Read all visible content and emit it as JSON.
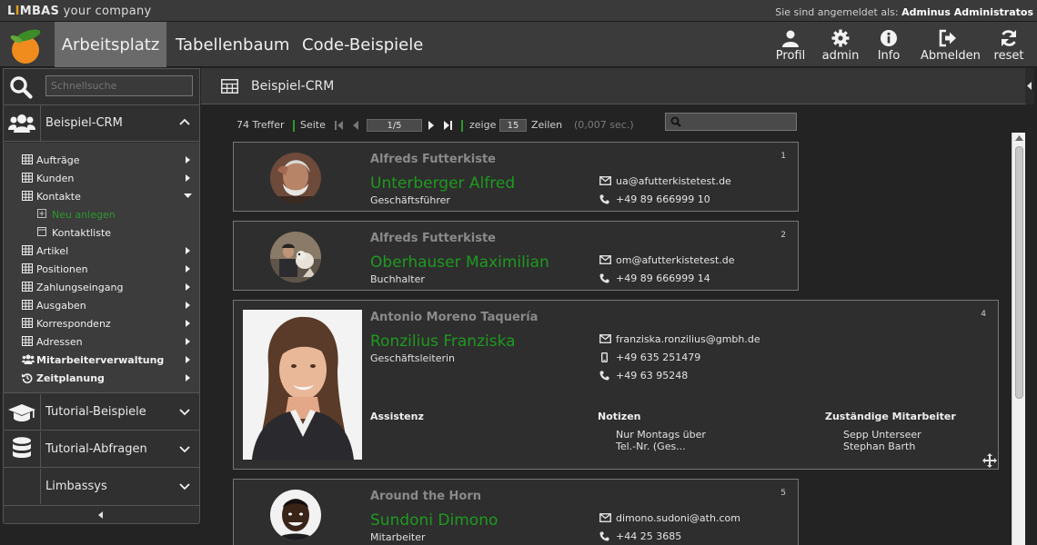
{
  "brand": {
    "name_prefix": "L",
    "name_i": "I",
    "name_suffix": "MBAS",
    "tagline": "your company"
  },
  "session": {
    "label": "Sie sind angemeldet als:",
    "user": "Adminus Administratos"
  },
  "nav": {
    "tabs": [
      {
        "label": "Arbeitsplatz",
        "active": true
      },
      {
        "label": "Tabellenbaum",
        "active": false
      },
      {
        "label": "Code-Beispiele",
        "active": false
      }
    ],
    "tools": [
      {
        "label": "Profil",
        "icon": "user-icon"
      },
      {
        "label": "admin",
        "icon": "gear-icon"
      },
      {
        "label": "Info",
        "icon": "info-icon"
      },
      {
        "label": "Abmelden",
        "icon": "logout-icon"
      },
      {
        "label": "reset",
        "icon": "refresh-icon"
      }
    ]
  },
  "sidebar": {
    "search_placeholder": "Schnellsuche",
    "groups": [
      {
        "label": "Beispiel-CRM",
        "icon": "users-icon",
        "expanded": true
      },
      {
        "label": "Tutorial-Beispiele",
        "icon": "graduation-cap-icon",
        "expanded": false
      },
      {
        "label": "Tutorial-Abfragen",
        "icon": "database-icon",
        "expanded": false
      },
      {
        "label": "Limbassys",
        "icon": "",
        "expanded": false
      }
    ],
    "tree": [
      {
        "label": "Aufträge",
        "icon": "table-icon"
      },
      {
        "label": "Kunden",
        "icon": "table-icon"
      },
      {
        "label": "Kontakte",
        "icon": "table-icon",
        "open": true
      },
      {
        "label": "Neu anlegen",
        "icon": "plus-square-icon",
        "sub": true
      },
      {
        "label": "Kontaktliste",
        "icon": "list-icon",
        "sub": true
      },
      {
        "label": "Artikel",
        "icon": "table-icon"
      },
      {
        "label": "Positionen",
        "icon": "table-icon"
      },
      {
        "label": "Zahlungseingang",
        "icon": "table-icon"
      },
      {
        "label": "Ausgaben",
        "icon": "table-icon"
      },
      {
        "label": "Korrespondenz",
        "icon": "table-icon"
      },
      {
        "label": "Adressen",
        "icon": "table-icon"
      },
      {
        "label": "Mitarbeiterverwaltung",
        "icon": "users-icon"
      },
      {
        "label": "Zeitplanung",
        "icon": "history-icon"
      }
    ]
  },
  "content": {
    "title": "Beispiel-CRM",
    "pager": {
      "hits": "74 Treffer",
      "page_label": "Seite",
      "page_value": "1/5",
      "show_label": "zeige",
      "rows_value": "15",
      "rows_label": "Zeilen",
      "timing": "(0,007 sec.)"
    },
    "cards": [
      {
        "num": "1",
        "company": "Alfreds Futterkiste",
        "name": "Unterberger Alfred",
        "role": "Geschäftsführer",
        "email": "ua@afutterkistetest.de",
        "phone": "+49 89 666999 10"
      },
      {
        "num": "2",
        "company": "Alfreds Futterkiste",
        "name": "Oberhauser Maximilian",
        "role": "Buchhalter",
        "email": "om@afutterkistetest.de",
        "phone": "+49 89 666999 14"
      },
      {
        "num": "4",
        "company": "Antonio Moreno Taquería",
        "name": "Ronzilius Franziska",
        "role": "Geschäftsleiterin",
        "email": "franziska.ronzilius@gmbh.de",
        "mobile": "+49 635 251479",
        "phone": "+49 63 95248",
        "sections": {
          "assistant_label": "Assistenz",
          "notes_label": "Notizen",
          "notes_text_1": "Nur Montags über",
          "notes_text_2": "Tel.-Nr. (Ges...",
          "staff_label": "Zuständige Mitarbeiter",
          "staff_1": "Sepp Unterseer",
          "staff_2": "Stephan Barth"
        }
      },
      {
        "num": "5",
        "company": "Around the Horn",
        "name": "Sundoni Dimono",
        "role": "Mitarbeiter",
        "email": "dimono.sudoni@ath.com",
        "phone": "+44 25 3685"
      }
    ]
  },
  "colors": {
    "accent_green": "#1e9a1e",
    "active_tab": "#6a6a6a",
    "logo_orange": "#f08c1e"
  }
}
